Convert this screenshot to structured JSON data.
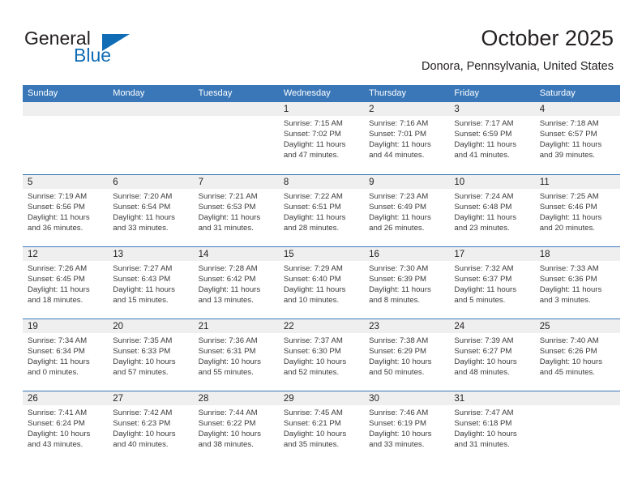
{
  "brand": {
    "word_one": "General",
    "word_two": "Blue",
    "flag_icon": "blue-triangle-flag-icon",
    "color_primary": "#0f6cb5",
    "color_text": "#231f20"
  },
  "header": {
    "title": "October 2025",
    "location": "Donora, Pennsylvania, United States"
  },
  "theme": {
    "header_bar_bg": "#3a77b8",
    "header_bar_text": "#ffffff",
    "daynum_band_bg": "#efefef",
    "row_divider": "#3a77b8",
    "body_text": "#3b3b3b"
  },
  "weekday_headers": [
    "Sunday",
    "Monday",
    "Tuesday",
    "Wednesday",
    "Thursday",
    "Friday",
    "Saturday"
  ],
  "weeks": [
    [
      {
        "day": "",
        "empty": true,
        "lines": []
      },
      {
        "day": "",
        "empty": true,
        "lines": []
      },
      {
        "day": "",
        "empty": true,
        "lines": []
      },
      {
        "day": "1",
        "empty": false,
        "lines": [
          "Sunrise: 7:15 AM",
          "Sunset: 7:02 PM",
          "Daylight: 11 hours",
          "and 47 minutes."
        ]
      },
      {
        "day": "2",
        "empty": false,
        "lines": [
          "Sunrise: 7:16 AM",
          "Sunset: 7:01 PM",
          "Daylight: 11 hours",
          "and 44 minutes."
        ]
      },
      {
        "day": "3",
        "empty": false,
        "lines": [
          "Sunrise: 7:17 AM",
          "Sunset: 6:59 PM",
          "Daylight: 11 hours",
          "and 41 minutes."
        ]
      },
      {
        "day": "4",
        "empty": false,
        "lines": [
          "Sunrise: 7:18 AM",
          "Sunset: 6:57 PM",
          "Daylight: 11 hours",
          "and 39 minutes."
        ]
      }
    ],
    [
      {
        "day": "5",
        "empty": false,
        "lines": [
          "Sunrise: 7:19 AM",
          "Sunset: 6:56 PM",
          "Daylight: 11 hours",
          "and 36 minutes."
        ]
      },
      {
        "day": "6",
        "empty": false,
        "lines": [
          "Sunrise: 7:20 AM",
          "Sunset: 6:54 PM",
          "Daylight: 11 hours",
          "and 33 minutes."
        ]
      },
      {
        "day": "7",
        "empty": false,
        "lines": [
          "Sunrise: 7:21 AM",
          "Sunset: 6:53 PM",
          "Daylight: 11 hours",
          "and 31 minutes."
        ]
      },
      {
        "day": "8",
        "empty": false,
        "lines": [
          "Sunrise: 7:22 AM",
          "Sunset: 6:51 PM",
          "Daylight: 11 hours",
          "and 28 minutes."
        ]
      },
      {
        "day": "9",
        "empty": false,
        "lines": [
          "Sunrise: 7:23 AM",
          "Sunset: 6:49 PM",
          "Daylight: 11 hours",
          "and 26 minutes."
        ]
      },
      {
        "day": "10",
        "empty": false,
        "lines": [
          "Sunrise: 7:24 AM",
          "Sunset: 6:48 PM",
          "Daylight: 11 hours",
          "and 23 minutes."
        ]
      },
      {
        "day": "11",
        "empty": false,
        "lines": [
          "Sunrise: 7:25 AM",
          "Sunset: 6:46 PM",
          "Daylight: 11 hours",
          "and 20 minutes."
        ]
      }
    ],
    [
      {
        "day": "12",
        "empty": false,
        "lines": [
          "Sunrise: 7:26 AM",
          "Sunset: 6:45 PM",
          "Daylight: 11 hours",
          "and 18 minutes."
        ]
      },
      {
        "day": "13",
        "empty": false,
        "lines": [
          "Sunrise: 7:27 AM",
          "Sunset: 6:43 PM",
          "Daylight: 11 hours",
          "and 15 minutes."
        ]
      },
      {
        "day": "14",
        "empty": false,
        "lines": [
          "Sunrise: 7:28 AM",
          "Sunset: 6:42 PM",
          "Daylight: 11 hours",
          "and 13 minutes."
        ]
      },
      {
        "day": "15",
        "empty": false,
        "lines": [
          "Sunrise: 7:29 AM",
          "Sunset: 6:40 PM",
          "Daylight: 11 hours",
          "and 10 minutes."
        ]
      },
      {
        "day": "16",
        "empty": false,
        "lines": [
          "Sunrise: 7:30 AM",
          "Sunset: 6:39 PM",
          "Daylight: 11 hours",
          "and 8 minutes."
        ]
      },
      {
        "day": "17",
        "empty": false,
        "lines": [
          "Sunrise: 7:32 AM",
          "Sunset: 6:37 PM",
          "Daylight: 11 hours",
          "and 5 minutes."
        ]
      },
      {
        "day": "18",
        "empty": false,
        "lines": [
          "Sunrise: 7:33 AM",
          "Sunset: 6:36 PM",
          "Daylight: 11 hours",
          "and 3 minutes."
        ]
      }
    ],
    [
      {
        "day": "19",
        "empty": false,
        "lines": [
          "Sunrise: 7:34 AM",
          "Sunset: 6:34 PM",
          "Daylight: 11 hours",
          "and 0 minutes."
        ]
      },
      {
        "day": "20",
        "empty": false,
        "lines": [
          "Sunrise: 7:35 AM",
          "Sunset: 6:33 PM",
          "Daylight: 10 hours",
          "and 57 minutes."
        ]
      },
      {
        "day": "21",
        "empty": false,
        "lines": [
          "Sunrise: 7:36 AM",
          "Sunset: 6:31 PM",
          "Daylight: 10 hours",
          "and 55 minutes."
        ]
      },
      {
        "day": "22",
        "empty": false,
        "lines": [
          "Sunrise: 7:37 AM",
          "Sunset: 6:30 PM",
          "Daylight: 10 hours",
          "and 52 minutes."
        ]
      },
      {
        "day": "23",
        "empty": false,
        "lines": [
          "Sunrise: 7:38 AM",
          "Sunset: 6:29 PM",
          "Daylight: 10 hours",
          "and 50 minutes."
        ]
      },
      {
        "day": "24",
        "empty": false,
        "lines": [
          "Sunrise: 7:39 AM",
          "Sunset: 6:27 PM",
          "Daylight: 10 hours",
          "and 48 minutes."
        ]
      },
      {
        "day": "25",
        "empty": false,
        "lines": [
          "Sunrise: 7:40 AM",
          "Sunset: 6:26 PM",
          "Daylight: 10 hours",
          "and 45 minutes."
        ]
      }
    ],
    [
      {
        "day": "26",
        "empty": false,
        "lines": [
          "Sunrise: 7:41 AM",
          "Sunset: 6:24 PM",
          "Daylight: 10 hours",
          "and 43 minutes."
        ]
      },
      {
        "day": "27",
        "empty": false,
        "lines": [
          "Sunrise: 7:42 AM",
          "Sunset: 6:23 PM",
          "Daylight: 10 hours",
          "and 40 minutes."
        ]
      },
      {
        "day": "28",
        "empty": false,
        "lines": [
          "Sunrise: 7:44 AM",
          "Sunset: 6:22 PM",
          "Daylight: 10 hours",
          "and 38 minutes."
        ]
      },
      {
        "day": "29",
        "empty": false,
        "lines": [
          "Sunrise: 7:45 AM",
          "Sunset: 6:21 PM",
          "Daylight: 10 hours",
          "and 35 minutes."
        ]
      },
      {
        "day": "30",
        "empty": false,
        "lines": [
          "Sunrise: 7:46 AM",
          "Sunset: 6:19 PM",
          "Daylight: 10 hours",
          "and 33 minutes."
        ]
      },
      {
        "day": "31",
        "empty": false,
        "lines": [
          "Sunrise: 7:47 AM",
          "Sunset: 6:18 PM",
          "Daylight: 10 hours",
          "and 31 minutes."
        ]
      },
      {
        "day": "",
        "empty": true,
        "lines": []
      }
    ]
  ]
}
